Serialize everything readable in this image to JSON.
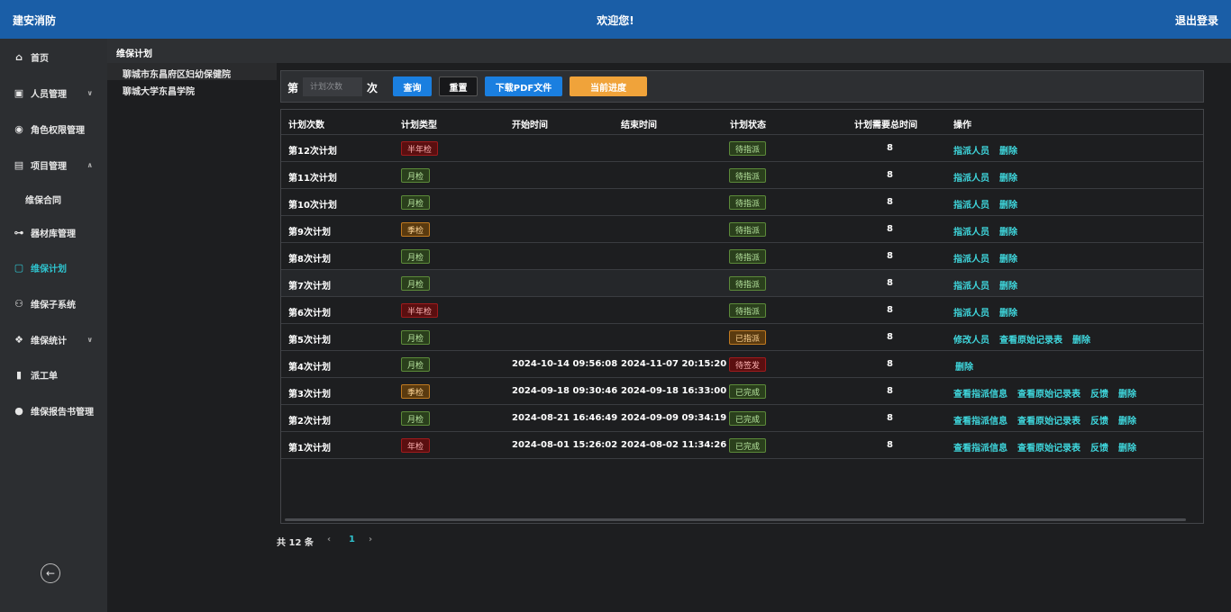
{
  "topbar": {
    "brand": "建安消防",
    "welcome": "欢迎您!",
    "logout": "退出登录"
  },
  "sidebar": {
    "items": [
      {
        "label": "首页",
        "icon": "home-icon",
        "glyph": "⌂"
      },
      {
        "label": "人员管理",
        "icon": "user-card-icon",
        "glyph": "▣",
        "chevron": "∨"
      },
      {
        "label": "角色权限管理",
        "icon": "compass-icon",
        "glyph": "◉"
      },
      {
        "label": "项目管理",
        "icon": "document-icon",
        "glyph": "▤",
        "chevron": "∧"
      },
      {
        "label": "维保合同",
        "sub": true
      },
      {
        "label": "器材库管理",
        "icon": "dumbbell-icon",
        "glyph": "⊶"
      },
      {
        "label": "维保计划",
        "icon": "calendar-icon",
        "glyph": "▢",
        "active": true
      },
      {
        "label": "维保子系统",
        "icon": "hierarchy-icon",
        "glyph": "⚇"
      },
      {
        "label": "维保统计",
        "icon": "cubes-icon",
        "glyph": "❖",
        "chevron": "∨"
      },
      {
        "label": "派工单",
        "icon": "file-icon",
        "glyph": "▮"
      },
      {
        "label": "维保报告书管理",
        "icon": "circle-icon",
        "glyph": "●"
      }
    ],
    "collapse_glyph": "←"
  },
  "breadcrumb": "维保计划",
  "orgs": [
    "聊城市东昌府区妇幼保健院",
    "聊城大学东昌学院"
  ],
  "search": {
    "prefix": "第",
    "placeholder": "计划次数",
    "suffix": "次",
    "query": "查询",
    "reset": "重置",
    "pdf": "下载PDF文件",
    "progress": "当前进度"
  },
  "table": {
    "headers": [
      "计划次数",
      "计划类型",
      "开始时间",
      "结束时间",
      "计划状态",
      "计划需要总时间",
      "操作"
    ],
    "rows": [
      {
        "name": "第12次计划",
        "type": "半年检",
        "type_color": "red",
        "start": "",
        "end": "",
        "state": "待指派",
        "state_color": "green",
        "total": "8",
        "actions": [
          "指派人员",
          "删除"
        ]
      },
      {
        "name": "第11次计划",
        "type": "月检",
        "type_color": "green",
        "start": "",
        "end": "",
        "state": "待指派",
        "state_color": "green",
        "total": "8",
        "actions": [
          "指派人员",
          "删除"
        ]
      },
      {
        "name": "第10次计划",
        "type": "月检",
        "type_color": "green",
        "start": "",
        "end": "",
        "state": "待指派",
        "state_color": "green",
        "total": "8",
        "actions": [
          "指派人员",
          "删除"
        ]
      },
      {
        "name": "第9次计划",
        "type": "季检",
        "type_color": "orange",
        "start": "",
        "end": "",
        "state": "待指派",
        "state_color": "green",
        "total": "8",
        "actions": [
          "指派人员",
          "删除"
        ]
      },
      {
        "name": "第8次计划",
        "type": "月检",
        "type_color": "green",
        "start": "",
        "end": "",
        "state": "待指派",
        "state_color": "green",
        "total": "8",
        "actions": [
          "指派人员",
          "删除"
        ]
      },
      {
        "name": "第7次计划",
        "type": "月检",
        "type_color": "green",
        "start": "",
        "end": "",
        "state": "待指派",
        "state_color": "green",
        "total": "8",
        "actions": [
          "指派人员",
          "删除"
        ],
        "hover": true
      },
      {
        "name": "第6次计划",
        "type": "半年检",
        "type_color": "red",
        "start": "",
        "end": "",
        "state": "待指派",
        "state_color": "green",
        "total": "8",
        "actions": [
          "指派人员",
          "删除"
        ]
      },
      {
        "name": "第5次计划",
        "type": "月检",
        "type_color": "green",
        "start": "",
        "end": "",
        "state": "已指派",
        "state_color": "orange",
        "total": "8",
        "actions": [
          "修改人员",
          "查看原始记录表",
          "删除"
        ]
      },
      {
        "name": "第4次计划",
        "type": "月检",
        "type_color": "green",
        "start": "2024-10-14 09:56:08",
        "end": "2024-11-07 20:15:20",
        "state": "待签发",
        "state_color": "red",
        "total": "8",
        "actions": [
          "删除"
        ]
      },
      {
        "name": "第3次计划",
        "type": "季检",
        "type_color": "orange",
        "start": "2024-09-18 09:30:46",
        "end": "2024-09-18 16:33:00",
        "state": "已完成",
        "state_color": "green",
        "total": "8",
        "actions": [
          "查看指派信息",
          "查看原始记录表",
          "反馈",
          "删除"
        ]
      },
      {
        "name": "第2次计划",
        "type": "月检",
        "type_color": "green",
        "start": "2024-08-21 16:46:49",
        "end": "2024-09-09 09:34:19",
        "state": "已完成",
        "state_color": "green",
        "total": "8",
        "actions": [
          "查看指派信息",
          "查看原始记录表",
          "反馈",
          "删除"
        ]
      },
      {
        "name": "第1次计划",
        "type": "年检",
        "type_color": "red",
        "start": "2024-08-01 15:26:02",
        "end": "2024-08-02 11:34:26",
        "state": "已完成",
        "state_color": "green",
        "total": "8",
        "actions": [
          "查看指派信息",
          "查看原始记录表",
          "反馈",
          "删除"
        ]
      }
    ]
  },
  "pager": {
    "total": "共 12 条",
    "prev": "‹",
    "current": "1",
    "next": "›"
  },
  "colors": {
    "topbar": "#1a5ea7",
    "accent": "#2fc3ce",
    "primary_btn": "#1a7fe0",
    "progress_btn": "#f0a33a"
  }
}
